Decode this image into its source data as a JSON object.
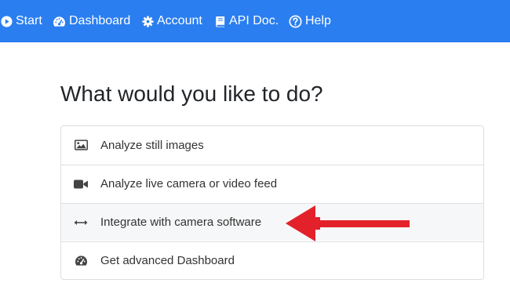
{
  "nav": {
    "items": [
      {
        "label": "Start",
        "icon": "play-circle-icon"
      },
      {
        "label": "Dashboard",
        "icon": "dashboard-icon"
      },
      {
        "label": "Account",
        "icon": "gear-icon"
      },
      {
        "label": "API Doc.",
        "icon": "book-icon"
      },
      {
        "label": "Help",
        "icon": "question-circle-icon"
      }
    ]
  },
  "main": {
    "title": "What would you like to do?",
    "options": [
      {
        "label": "Analyze still images",
        "icon": "image-icon"
      },
      {
        "label": "Analyze live camera or video feed",
        "icon": "video-camera-icon"
      },
      {
        "label": "Integrate with camera software",
        "icon": "arrows-horizontal-icon"
      },
      {
        "label": "Get advanced Dashboard",
        "icon": "dashboard-icon"
      }
    ]
  },
  "colors": {
    "navbar": "#2a7ef0",
    "annotation_arrow": "#e3212b",
    "highlight_row": "#f6f7f8"
  }
}
